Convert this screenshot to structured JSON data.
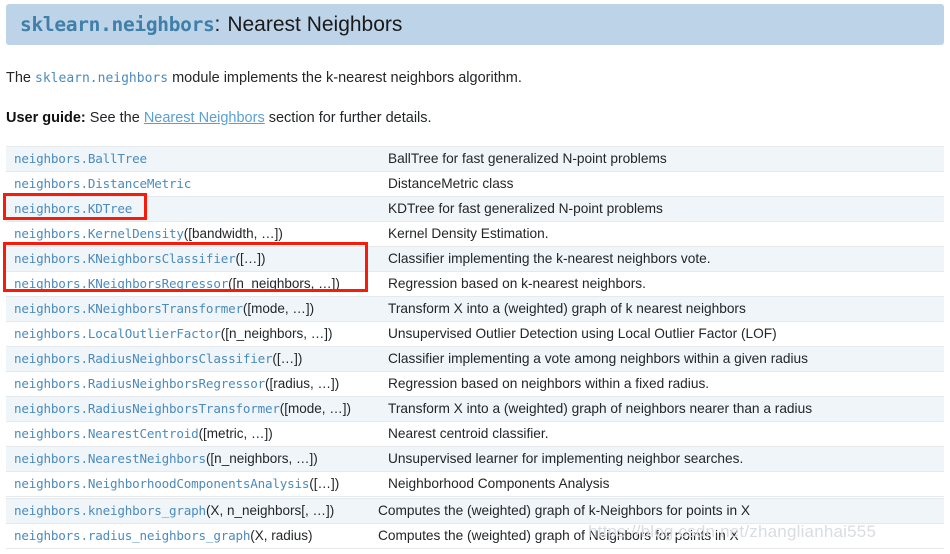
{
  "header": {
    "module": "sklearn.neighbors",
    "separator": ":",
    "title": "Nearest Neighbors"
  },
  "intro": {
    "line1_before": "The ",
    "line1_code": "sklearn.neighbors",
    "line1_after": " module implements the k-nearest neighbors algorithm.",
    "line2_label": "User guide:",
    "line2_before": " See the ",
    "line2_link": "Nearest Neighbors",
    "line2_after": " section for further details."
  },
  "classes_table": [
    {
      "name": "neighbors.BallTree",
      "args": "",
      "desc": "BallTree for fast generalized N-point problems"
    },
    {
      "name": "neighbors.DistanceMetric",
      "args": "",
      "desc": "DistanceMetric class"
    },
    {
      "name": "neighbors.KDTree",
      "args": "",
      "desc": "KDTree for fast generalized N-point problems"
    },
    {
      "name": "neighbors.KernelDensity",
      "args": "([bandwidth, …])",
      "desc": "Kernel Density Estimation."
    },
    {
      "name": "neighbors.KNeighborsClassifier",
      "args": "([…])",
      "desc": "Classifier implementing the k-nearest neighbors vote."
    },
    {
      "name": "neighbors.KNeighborsRegressor",
      "args": "([n_neighbors, …])",
      "desc": "Regression based on k-nearest neighbors."
    },
    {
      "name": "neighbors.KNeighborsTransformer",
      "args": "([mode, …])",
      "desc": "Transform X into a (weighted) graph of k nearest neighbors"
    },
    {
      "name": "neighbors.LocalOutlierFactor",
      "args": "([n_neighbors, …])",
      "desc": "Unsupervised Outlier Detection using Local Outlier Factor (LOF)"
    },
    {
      "name": "neighbors.RadiusNeighborsClassifier",
      "args": "([…])",
      "desc": "Classifier implementing a vote among neighbors within a given radius"
    },
    {
      "name": "neighbors.RadiusNeighborsRegressor",
      "args": "([radius, …])",
      "desc": "Regression based on neighbors within a fixed radius."
    },
    {
      "name": "neighbors.RadiusNeighborsTransformer",
      "args": "([mode, …])",
      "desc": "Transform X into a (weighted) graph of neighbors nearer than a radius"
    },
    {
      "name": "neighbors.NearestCentroid",
      "args": "([metric, …])",
      "desc": "Nearest centroid classifier."
    },
    {
      "name": "neighbors.NearestNeighbors",
      "args": "([n_neighbors, …])",
      "desc": "Unsupervised learner for implementing neighbor searches."
    },
    {
      "name": "neighbors.NeighborhoodComponentsAnalysis",
      "args": "([…])",
      "desc": "Neighborhood Components Analysis"
    }
  ],
  "functions_table": [
    {
      "name": "neighbors.kneighbors_graph",
      "args": "(X, n_neighbors[, …])",
      "desc": "Computes the (weighted) graph of k-Neighbors for points in X"
    },
    {
      "name": "neighbors.radius_neighbors_graph",
      "args": "(X, radius)",
      "desc": "Computes the (weighted) graph of Neighbors for points in X"
    }
  ],
  "annotations": {
    "box1_target": "neighbors.KDTree",
    "box2_target": "neighbors.KNeighborsClassifier / neighbors.KNeighborsRegressor",
    "color": "#f81b0a"
  },
  "watermark": {
    "text": "https://blog.csdn.net/zhanglianhai555"
  },
  "colors": {
    "banner_bg": "#bcd3e8",
    "link": "#5a9fd4",
    "code": "#4b8bbe",
    "row_stripe": "#eff5f9",
    "text": "#232629"
  }
}
